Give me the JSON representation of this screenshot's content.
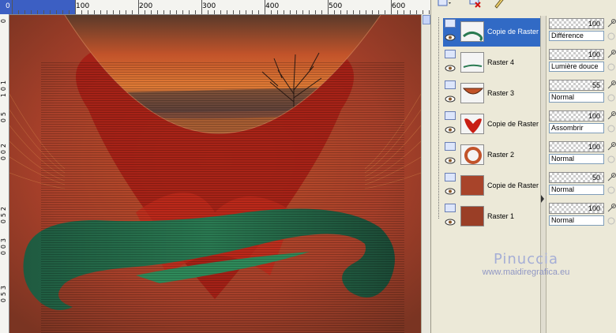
{
  "ruler": {
    "h_labels": [
      "0",
      "100",
      "200",
      "300",
      "400",
      "500",
      "600"
    ],
    "v_labels": [
      "0",
      "1",
      "0",
      "1",
      "5",
      "0",
      "2",
      "0",
      "0",
      "2",
      "5",
      "0",
      "3",
      "0",
      "0",
      "3",
      "5",
      "0"
    ]
  },
  "layers": [
    {
      "name": "Copie de Raster",
      "selected": true,
      "thumb": "swirl-green"
    },
    {
      "name": "Raster 4",
      "selected": false,
      "thumb": "swirl-green-small"
    },
    {
      "name": "Raster 3",
      "selected": false,
      "thumb": "bowl-red"
    },
    {
      "name": "Copie de Raster",
      "selected": false,
      "thumb": "heart-red"
    },
    {
      "name": "Raster 2",
      "selected": false,
      "thumb": "ring-red"
    },
    {
      "name": "Copie de Raster",
      "selected": false,
      "thumb": "texture-rust"
    },
    {
      "name": "Raster 1",
      "selected": false,
      "thumb": "texture-rust"
    }
  ],
  "layer_props": [
    {
      "opacity": "100",
      "blend": "Différence"
    },
    {
      "opacity": "100",
      "blend": "Lumière douce"
    },
    {
      "opacity": "55",
      "blend": "Normal"
    },
    {
      "opacity": "100",
      "blend": "Assombrir"
    },
    {
      "opacity": "100",
      "blend": "Normal"
    },
    {
      "opacity": "50",
      "blend": "Normal"
    },
    {
      "opacity": "100",
      "blend": "Normal"
    }
  ],
  "watermark": {
    "name": "Pinuccia",
    "url": "www.maidiregrafica.eu"
  },
  "colors": {
    "selection": "#316ac5",
    "ruler_sel": "#3c5fc3",
    "palette_bg": "#ece9d8"
  },
  "icons": [
    "layer-icon",
    "delete-layer-icon",
    "edit-icon",
    "eye-icon",
    "lock-icon",
    "link-icon"
  ]
}
